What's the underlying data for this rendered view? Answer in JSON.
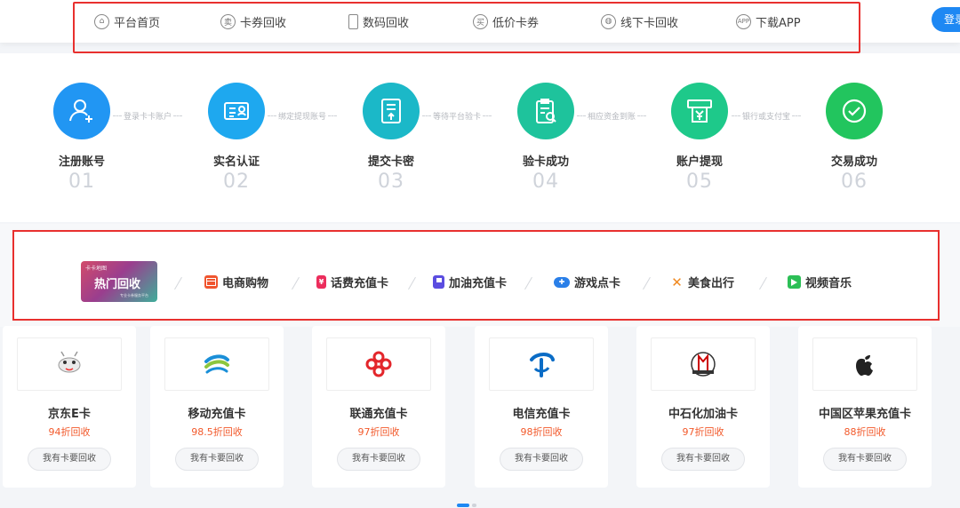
{
  "nav": {
    "items": [
      {
        "label": "平台首页",
        "icon": "home-icon"
      },
      {
        "label": "卡券回收",
        "icon": "sell-icon"
      },
      {
        "label": "数码回收",
        "icon": "phone-icon"
      },
      {
        "label": "低价卡券",
        "icon": "buy-icon"
      },
      {
        "label": "线下卡回收",
        "icon": "globe-icon"
      },
      {
        "label": "下载APP",
        "icon": "app-icon"
      }
    ],
    "login_label": "登录"
  },
  "steps": [
    {
      "name": "注册账号",
      "num": "01",
      "color": "#2196f3",
      "icon": "user-add-icon"
    },
    {
      "name": "实名认证",
      "num": "02",
      "color": "#1ea8ef",
      "icon": "id-card-icon"
    },
    {
      "name": "提交卡密",
      "num": "03",
      "color": "#1bb8c8",
      "icon": "upload-doc-icon"
    },
    {
      "name": "验卡成功",
      "num": "04",
      "color": "#1ec39c",
      "icon": "check-doc-icon"
    },
    {
      "name": "账户提现",
      "num": "05",
      "color": "#1ec98a",
      "icon": "withdraw-icon"
    },
    {
      "name": "交易成功",
      "num": "06",
      "color": "#22c55e",
      "icon": "check-circle-icon"
    }
  ],
  "connectors": [
    "登录卡卡账户",
    "绑定提现账号",
    "等待平台验卡",
    "相应资金到账",
    "银行或支付宝"
  ],
  "categories": {
    "hot": {
      "small": "卡卡地图",
      "big": "热门回收",
      "tiny": "专业卡券服务平台"
    },
    "items": [
      {
        "label": "电商购物",
        "color": "#f0552f",
        "icon": "shopping-card-icon"
      },
      {
        "label": "话费充值卡",
        "color": "#ec2d5c",
        "icon": "phone-bill-icon"
      },
      {
        "label": "加油充值卡",
        "color": "#5b4de0",
        "icon": "fuel-icon"
      },
      {
        "label": "游戏点卡",
        "color": "#2a7fe8",
        "icon": "gamepad-icon"
      },
      {
        "label": "美食出行",
        "color": "#f08a22",
        "icon": "food-icon"
      },
      {
        "label": "视频音乐",
        "color": "#2cbf56",
        "icon": "video-icon"
      }
    ]
  },
  "cards": [
    {
      "title": "京东E卡",
      "rate": "94折回收",
      "btn": "我有卡要回收",
      "logo": "jd-dog-icon"
    },
    {
      "title": "移动充值卡",
      "rate": "98.5折回收",
      "btn": "我有卡要回收",
      "logo": "china-mobile-icon"
    },
    {
      "title": "联通充值卡",
      "rate": "97折回收",
      "btn": "我有卡要回收",
      "logo": "china-unicom-icon"
    },
    {
      "title": "电信充值卡",
      "rate": "98折回收",
      "btn": "我有卡要回收",
      "logo": "china-telecom-icon"
    },
    {
      "title": "中石化加油卡",
      "rate": "97折回收",
      "btn": "我有卡要回收",
      "logo": "sinopec-icon"
    },
    {
      "title": "中国区苹果充值卡",
      "rate": "88折回收",
      "btn": "我有卡要回收",
      "logo": "apple-icon"
    }
  ]
}
